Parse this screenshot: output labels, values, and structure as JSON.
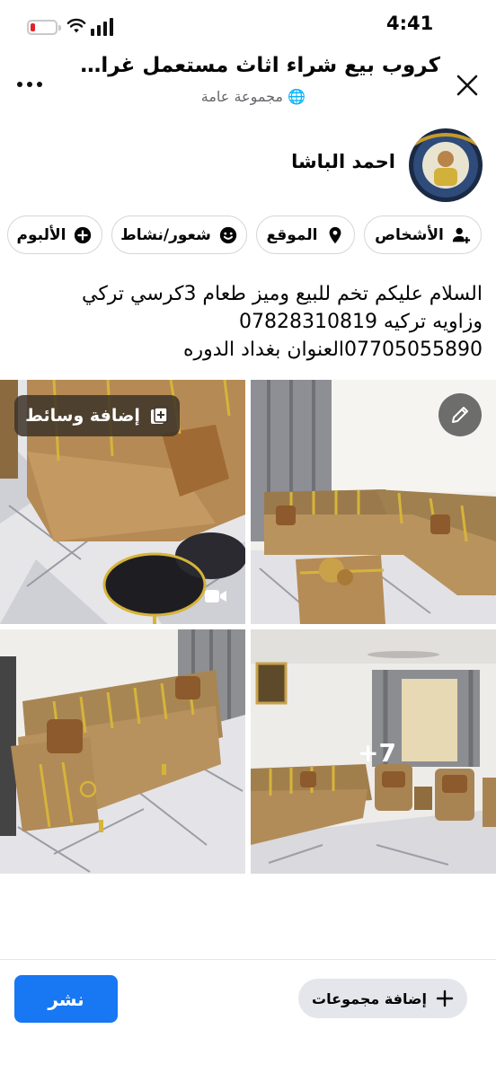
{
  "status_bar": {
    "time": "4:41"
  },
  "header": {
    "title": "كروب بيع شراء اثاث مستعمل غراض من...",
    "subtitle": "مجموعة عامة"
  },
  "author": {
    "name": "احمد الباشا"
  },
  "chips": [
    {
      "label": "الأشخاص",
      "icon": "people-icon"
    },
    {
      "label": "الموقع",
      "icon": "location-pin-icon"
    },
    {
      "label": "شعور/نشاط",
      "icon": "smiley-icon"
    },
    {
      "label": "الألبوم",
      "icon": "plus-circle-icon"
    }
  ],
  "post": {
    "text": "السلام عليكم تخم  للبيع وميز طعام 3كرسي تركي\nوزاويه تركيه 07828310819\n07705055890العنوان بغداد الدوره"
  },
  "media": {
    "add_media_label": "إضافة وسائط",
    "more_count": "+7"
  },
  "bottom": {
    "add_groups_label": "إضافة مجموعات",
    "publish_label": "نشر"
  },
  "colors": {
    "accent": "#1877f2",
    "battery_low": "#e0242c"
  }
}
